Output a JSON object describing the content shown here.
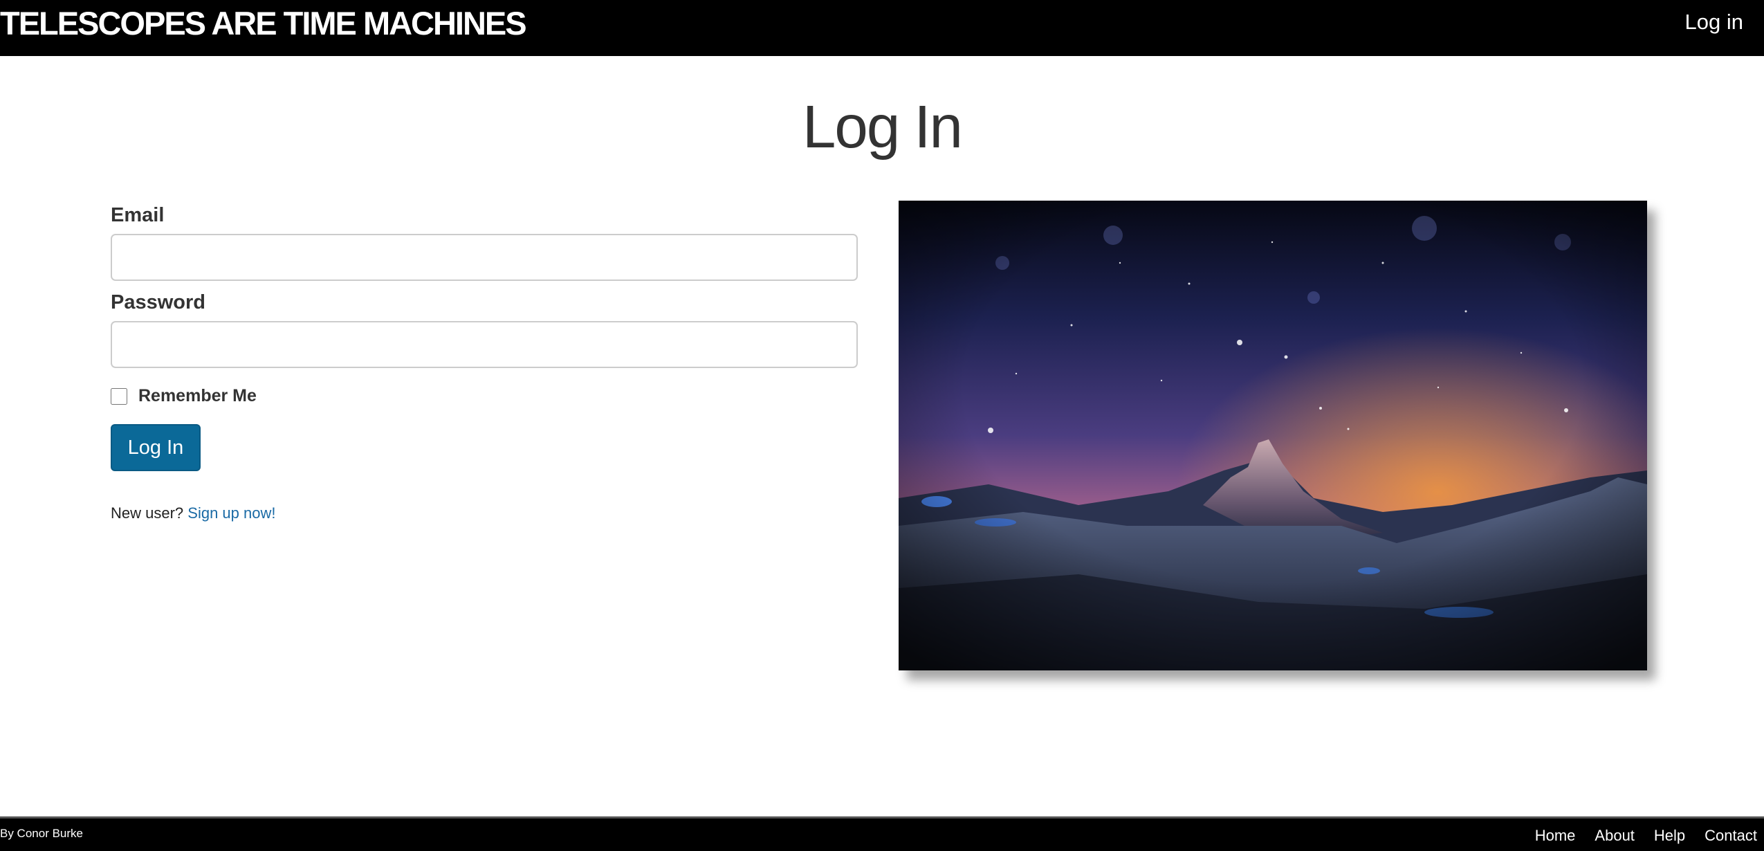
{
  "header": {
    "brand": "TELESCOPES ARE TIME MACHINES",
    "login_link": "Log in"
  },
  "main": {
    "title": "Log In",
    "form": {
      "email_label": "Email",
      "email_value": "",
      "password_label": "Password",
      "password_value": "",
      "remember_label": "Remember Me",
      "remember_checked": false,
      "submit_label": "Log In"
    },
    "signup": {
      "prompt": "New user?",
      "link_text": "Sign up now!"
    },
    "image": {
      "icon": "night-mountain-photo"
    }
  },
  "footer": {
    "credit": "By Conor Burke",
    "links": [
      "Home",
      "About",
      "Help",
      "Contact"
    ]
  },
  "colors": {
    "header_bg": "#000000",
    "button_bg": "#0b6998",
    "link": "#1a6aa5",
    "text": "#333333"
  }
}
